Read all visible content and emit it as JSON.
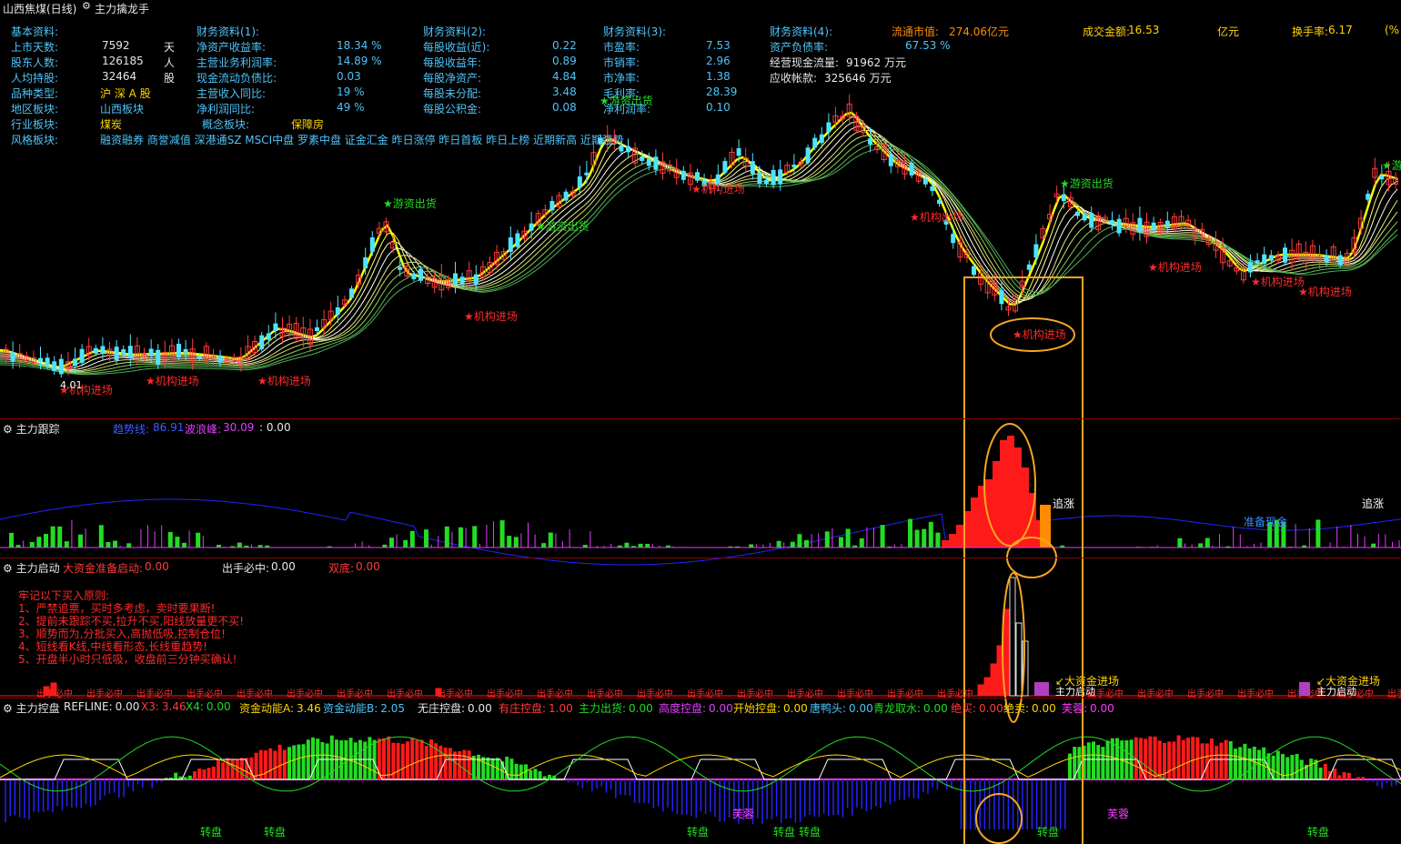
{
  "header": {
    "stock_title": "山西焦煤(日线)",
    "indicator_name": "主力擒龙手"
  },
  "info_left": {
    "title": "基本资料:",
    "rows": [
      {
        "label": "上市天数:",
        "value": "7592",
        "unit": "天"
      },
      {
        "label": "股东人数:",
        "value": "126185",
        "unit": "人"
      },
      {
        "label": "人均持股:",
        "value": "32464",
        "unit": "股"
      },
      {
        "label": "品种类型:",
        "value": "沪 深 A 股",
        "unit": ""
      },
      {
        "label": "地区板块:",
        "value": "山西板块",
        "unit": ""
      },
      {
        "label": "行业板块:",
        "value": "煤炭",
        "unit": ""
      },
      {
        "label": "风格板块:",
        "value": "融资融券 商誉减值 深港通SZ MSCI中盘 罗素中盘 证金汇金 昨日涨停 昨日首板 昨日上榜 近期新高 近期强势",
        "unit": ""
      }
    ],
    "concept_label": "概念板块:",
    "concept_value": "保障房"
  },
  "fin1": {
    "title": "财务资料(1):",
    "rows": [
      {
        "label": "净资产收益率:",
        "value": "18.34 %"
      },
      {
        "label": "主营业务利润率:",
        "value": "14.89 %"
      },
      {
        "label": "现金流动负债比:",
        "value": "0.03"
      },
      {
        "label": "主营收入同比:",
        "value": "19 %"
      },
      {
        "label": "净利润同比:",
        "value": "49 %"
      }
    ]
  },
  "fin2": {
    "title": "财务资料(2):",
    "rows": [
      {
        "label": "每股收益(近):",
        "value": "0.22"
      },
      {
        "label": "每股收益年:",
        "value": "0.89"
      },
      {
        "label": "每股净资产:",
        "value": "4.84"
      },
      {
        "label": "每股未分配:",
        "value": "3.48"
      },
      {
        "label": "每股公积金:",
        "value": "0.08"
      }
    ]
  },
  "fin3": {
    "title": "财务资料(3):",
    "rows": [
      {
        "label": "市盈率:",
        "value": "7.53"
      },
      {
        "label": "市销率:",
        "value": "2.96"
      },
      {
        "label": "市净率:",
        "value": "1.38"
      },
      {
        "label": "毛利率:",
        "value": "28.39"
      },
      {
        "label": "净利润率:",
        "value": "0.10"
      }
    ]
  },
  "fin4": {
    "title": "财务资料(4):",
    "rows": [
      {
        "label": "资产负债率:",
        "value": "67.53 %"
      },
      {
        "label": "经营现金流量:",
        "value": "91962 万元"
      },
      {
        "label": "应收帐款:",
        "value": "325646 万元"
      }
    ]
  },
  "market": {
    "float_cap_label": "流通市值:",
    "float_cap_value": "274.06亿元",
    "turnover_label": "成交金额:",
    "turnover_value": "16.53",
    "turnover_unit": "亿元",
    "turnover_rate_label": "换手率:",
    "turnover_rate_value": "6.17",
    "turnover_rate_unit": "(%"
  },
  "main_signals": {
    "escape": "游资出货",
    "inst_in": "机构进场",
    "inst_out": "机构出场",
    "low_price": "4.01"
  },
  "panel2": {
    "name": "主力跟踪",
    "trend_label": "趋势线:",
    "trend_value": "86.91",
    "wave_label": "波浪峰:",
    "wave_value": "30.09",
    "third": ": 0.00",
    "chase": "追涨",
    "prepare": "准备现金"
  },
  "panel3": {
    "name": "主力启动",
    "big_label": "大资金准备启动:",
    "big_value": "0.00",
    "hit_label": "出手必中:",
    "hit_value": "0.00",
    "double_label": "双底:",
    "double_value": "0.00",
    "rules": [
      "牢记以下买入原则:",
      "1、严禁追票，买时多考虑，卖时要果断!",
      "2、提前未跟踪不买,拉升不买,阳线放量更不买!",
      "3、顺势而为,分批买入,高抛低吸,控制仓位!",
      "4、短线看K线,中线看形态,长线重趋势!",
      "5、开盘半小时只低吸，收盘前三分钟买确认!"
    ],
    "enter": "大资金进场",
    "ready": "主力启动",
    "hit_text": "出手必中"
  },
  "panel4": {
    "name": "主力控盘",
    "items": [
      {
        "label": "REFLINE:",
        "value": "0.00",
        "color": "#e6e6e6"
      },
      {
        "label": "X3:",
        "value": "3.46",
        "color": "#ff3b3b"
      },
      {
        "label": "X4:",
        "value": "0.00",
        "color": "#22dd22"
      },
      {
        "label": "资金动能A:",
        "value": "3.46",
        "color": "#ffd400"
      },
      {
        "label": "资金动能B:",
        "value": "2.05",
        "color": "#4fc3f7"
      },
      {
        "label": "无庄控盘:",
        "value": "0.00",
        "color": "#e6e6e6"
      },
      {
        "label": "有庄控盘:",
        "value": "1.00",
        "color": "#ff3b3b"
      },
      {
        "label": "主力出货:",
        "value": "0.00",
        "color": "#22dd22"
      },
      {
        "label": "高度控盘:",
        "value": "0.00",
        "color": "#e040fb"
      },
      {
        "label": "开始控盘:",
        "value": "0.00",
        "color": "#ffd400"
      },
      {
        "label": "唐鸭头:",
        "value": "0.00",
        "color": "#4fc3f7"
      },
      {
        "label": "青龙取水:",
        "value": "0.00",
        "color": "#22dd22"
      },
      {
        "label": "绝买:",
        "value": "0.00",
        "color": "#ff3b3b"
      },
      {
        "label": "绝卖:",
        "value": "0.00",
        "color": "#ffd400"
      },
      {
        "label": "芙蓉:",
        "value": "0.00",
        "color": "#ff3bff"
      }
    ],
    "turn": "转盘",
    "lotus": "芙蓉"
  },
  "colors": {
    "up": "#ff3b3b",
    "down": "#4fe3ff",
    "bg": "#000000",
    "sep": "#8b0000",
    "highlight": "#f5a623"
  }
}
